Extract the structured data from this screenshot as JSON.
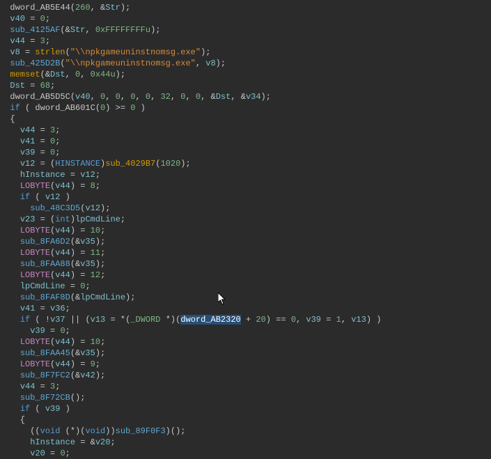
{
  "selected_symbol": "dword_AB2320",
  "tokens": {
    "dword_AB5E44": "dword_AB5E44",
    "num260": "260",
    "Str": "Str",
    "v40": "v40",
    "num0": "0",
    "sub_4125AF": "sub_4125AF",
    "hexF": "0xFFFFFFFFu",
    "v44": "v44",
    "num3": "3",
    "v8": "v8",
    "strlen": "strlen",
    "pathStr": "\"\\\\npkgameuninstnomsg.exe\"",
    "sub_425D2B": "sub_425D2B",
    "memset": "memset",
    "Dst": "Dst",
    "hex44": "0x44u",
    "num68": "68",
    "dword_AB5D5C": "dword_AB5D5C",
    "num32": "32",
    "v34": "v34",
    "kw_if": "if",
    "dword_AB601C": "dword_AB601C",
    "v41": "v41",
    "v39": "v39",
    "v12": "v12",
    "HINSTANCE": "HINSTANCE",
    "sub_4029B7": "sub_4029B7",
    "num1020": "1020",
    "hInstance": "hInstance",
    "LOBYTE": "LOBYTE",
    "num8": "8",
    "sub_48C3D5": "sub_48C3D5",
    "v23": "v23",
    "int": "int",
    "lpCmdLine": "lpCmdLine",
    "num10": "10",
    "sub_8FA6D2": "sub_8FA6D2",
    "v35": "v35",
    "num11": "11",
    "sub_8FAA88": "sub_8FAA88",
    "num12": "12",
    "sub_8FAF8D": "sub_8FAF8D",
    "v36": "v36",
    "v37": "v37",
    "v13": "v13",
    "DWORD": "_DWORD",
    "dword_AB2320": "dword_AB2320",
    "num20": "20",
    "num1": "1",
    "sub_8FAA45": "sub_8FAA45",
    "num9": "9",
    "sub_8F7FC2": "sub_8F7FC2",
    "v42": "v42",
    "sub_8F72CB": "sub_8F72CB",
    "void": "void",
    "sub_89F0F3": "sub_89F0F3",
    "v20": "v20"
  }
}
